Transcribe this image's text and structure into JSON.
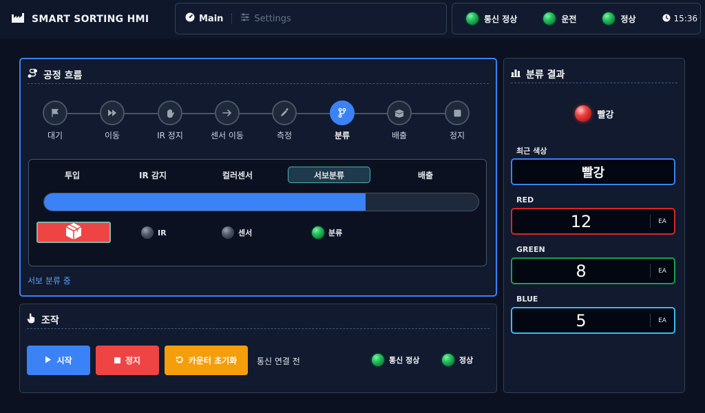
{
  "header": {
    "brand": "SMART SORTING HMI",
    "nav": {
      "main": "Main",
      "settings": "Settings"
    },
    "status": {
      "comm": "통신 정상",
      "run": "운전",
      "ok": "정상",
      "time": "15:36"
    }
  },
  "process": {
    "title": "공정 흐름",
    "steps": [
      "대기",
      "이동",
      "IR 정지",
      "센서 이동",
      "측정",
      "분류",
      "배출",
      "정지"
    ],
    "active_step": "분류",
    "flow_tabs": [
      "투입",
      "IR 감지",
      "컬러센서",
      "서보분류",
      "배출"
    ],
    "active_tab": "서보분류",
    "progress_percent": 74,
    "indicators": {
      "ir": "IR",
      "sensor": "센서",
      "sort": "분류"
    },
    "status_message": "서보 분류 중"
  },
  "control": {
    "title": "조작",
    "start_label": "시작",
    "stop_label": "정지",
    "reset_label": "카운터 초기화",
    "connection_text": "통신 연결 전",
    "comm_status": "통신 정상",
    "ok_status": "정상"
  },
  "result": {
    "title": "분류 결과",
    "current_color": "빨강",
    "recent_label": "최근 색상",
    "recent_value": "빨강",
    "red_label": "RED",
    "red_count": "12",
    "green_label": "GREEN",
    "green_count": "8",
    "blue_label": "BLUE",
    "blue_count": "5",
    "unit": "EA"
  },
  "colors": {
    "accent": "#3b82f6",
    "danger": "#ef4444",
    "warning": "#f59e0b",
    "success": "#22c55e"
  }
}
